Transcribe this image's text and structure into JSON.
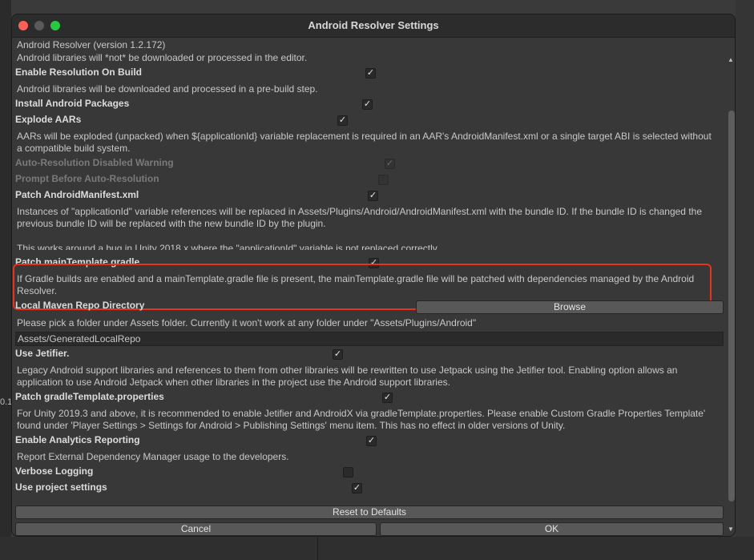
{
  "window": {
    "title": "Android Resolver Settings"
  },
  "background": {
    "left_text": "0.1"
  },
  "settings": {
    "version": "Android Resolver (version 1.2.172)",
    "enable_resolution_desc": "Android libraries will *not* be downloaded or processed in the editor.",
    "enable_resolution_label": "Enable Resolution On Build",
    "enable_resolution_after_desc": "Android libraries will be downloaded and processed in a pre-build step.",
    "install_packages_label": "Install Android Packages",
    "explode_aars_label": "Explode AARs",
    "explode_aars_desc": "AARs will be exploded (unpacked) when ${applicationId} variable replacement is required in an AAR's AndroidManifest.xml or a single target ABI is selected without a compatible build system.",
    "auto_resolution_warning_label": "Auto-Resolution Disabled Warning",
    "prompt_before_label": "Prompt Before Auto-Resolution",
    "patch_manifest_label": "Patch AndroidManifest.xml",
    "patch_manifest_desc": "Instances of \"applicationId\" variable references will be replaced in Assets/Plugins/Android/AndroidManifest.xml with the bundle ID.  If the bundle ID is changed the previous bundle ID will be replaced with the new bundle ID by the plugin.",
    "patch_manifest_desc2": "This works around a bug in Unity 2018.x where the \"applicationId\" variable is not replaced correctly.",
    "patch_main_template_label": "Patch mainTemplate.gradle",
    "patch_main_template_desc": "If Gradle builds are enabled and a mainTemplate.gradle file is present, the mainTemplate.gradle file will be patched with dependencies managed by the Android Resolver.",
    "local_maven_label": "Local Maven Repo Directory",
    "browse_label": "Browse",
    "local_maven_desc": "Please pick a folder under Assets folder.  Currently it won't work at any folder under \"Assets/Plugins/Android\"",
    "local_maven_path": "Assets/GeneratedLocalRepo",
    "jetifier_label": "Use Jetifier.",
    "jetifier_desc": "Legacy Android support libraries and references to them from other libraries will be rewritten to use Jetpack using the Jetifier tool. Enabling option allows an application to use Android Jetpack when other libraries in the project use the Android support libraries.",
    "patch_gradle_props_label": "Patch gradleTemplate.properties",
    "patch_gradle_props_desc": "For Unity 2019.3 and above, it is recommended to enable Jetifier and AndroidX via gradleTemplate.properties. Please enable Custom Gradle Properties Template' found under 'Player Settings > Settings for Android > Publishing Settings' menu item. This has no effect in older versions of Unity.",
    "analytics_label": "Enable Analytics Reporting",
    "analytics_desc": "Report External Dependency Manager usage to the developers.",
    "verbose_label": "Verbose Logging",
    "project_settings_label": "Use project settings"
  },
  "checkboxes": {
    "enable_resolution": "✓",
    "install_packages": "✓",
    "explode_aars": "✓",
    "auto_resolution_warning": "✓",
    "prompt_before": "",
    "patch_manifest": "✓",
    "patch_main_template": "✓",
    "jetifier": "✓",
    "patch_gradle_props": "✓",
    "analytics": "✓",
    "verbose": "",
    "project_settings": "✓"
  },
  "buttons": {
    "reset": "Reset to Defaults",
    "cancel": "Cancel",
    "ok": "OK"
  },
  "colors": {
    "highlight": "#e8321e",
    "window_bg": "#383838"
  }
}
